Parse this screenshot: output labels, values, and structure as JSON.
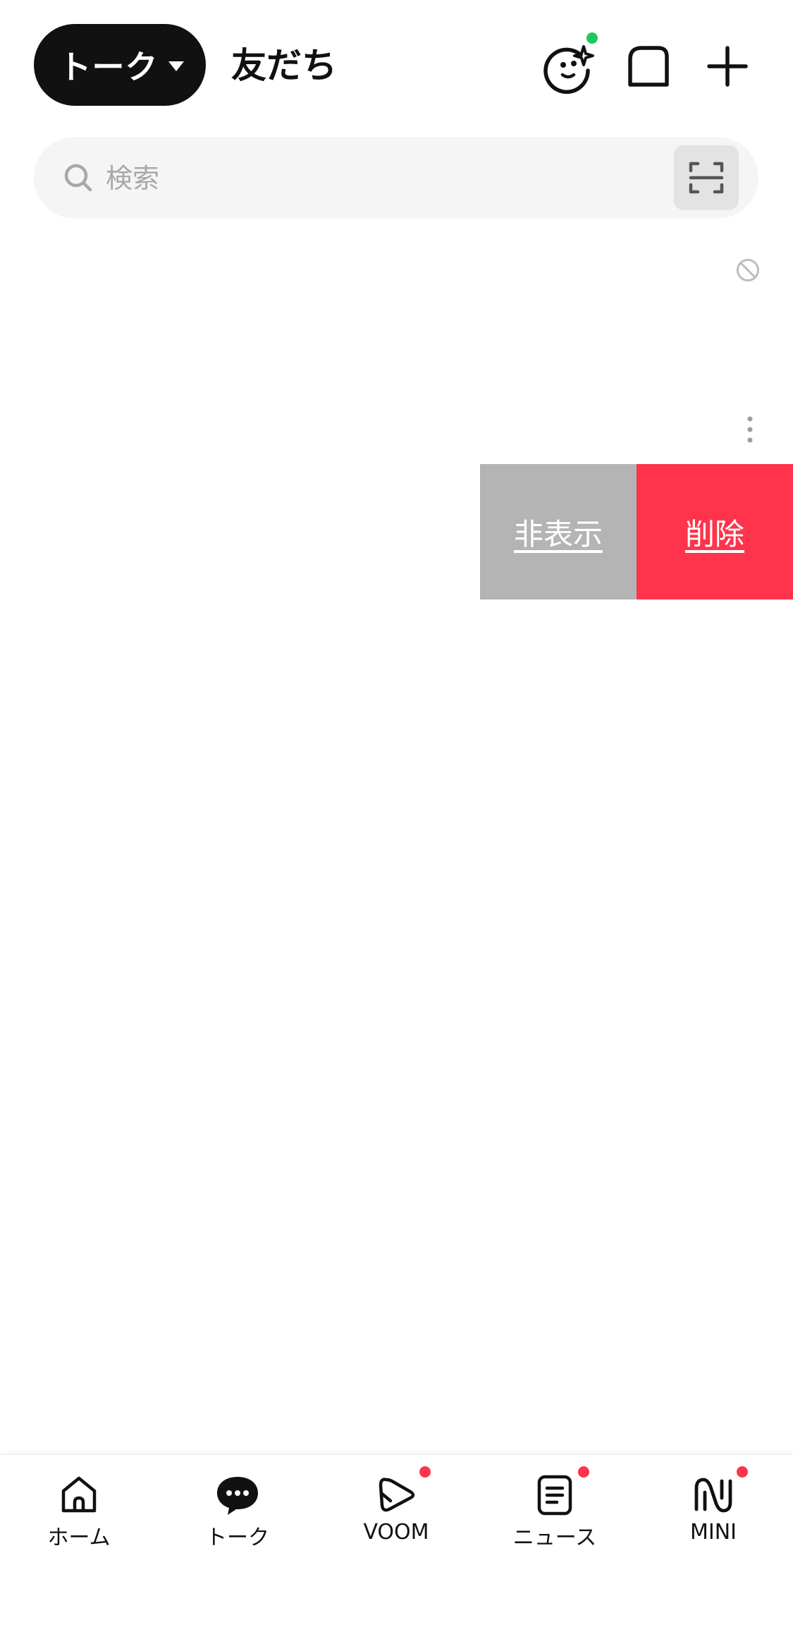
{
  "header": {
    "active_tab": "トーク",
    "friends_tab": "友だち",
    "icons": [
      "face-sparkle-icon",
      "square-icon",
      "plus-icon"
    ],
    "status_dot_color": "#1ec95a"
  },
  "search": {
    "placeholder": "検索",
    "scan_icon": "qr-scan-icon"
  },
  "content": {
    "hide_label": "非表示",
    "delete_label": "削除",
    "hide_color": "#b4b4b4",
    "delete_color": "#ff334b"
  },
  "bottom_nav": {
    "items": [
      {
        "label": "ホーム",
        "icon": "home-icon",
        "badge": false
      },
      {
        "label": "トーク",
        "icon": "talk-bubble-icon",
        "badge": false,
        "active": true
      },
      {
        "label": "VOOM",
        "icon": "voom-play-icon",
        "badge": true
      },
      {
        "label": "ニュース",
        "icon": "news-icon",
        "badge": true
      },
      {
        "label": "MINI",
        "icon": "mini-icon",
        "badge": true
      }
    ],
    "badge_color": "#ff334b"
  }
}
